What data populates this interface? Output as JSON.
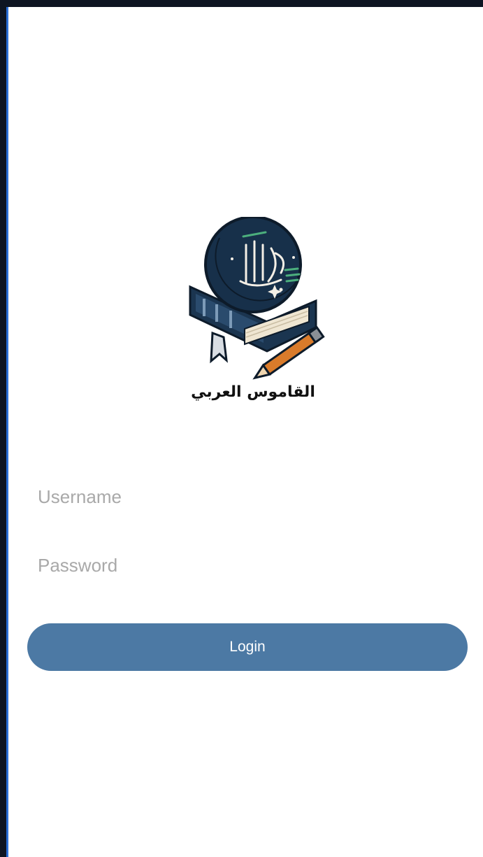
{
  "app": {
    "logo_icon": "dictionary-book-crescent-logo",
    "logo_title": "القاموس العربي"
  },
  "form": {
    "username_placeholder": "Username",
    "username_value": "",
    "password_placeholder": "Password",
    "password_value": "",
    "login_label": "Login"
  },
  "colors": {
    "primary_button": "#4c79a4",
    "placeholder_text": "#a9a9a9",
    "background": "#ffffff",
    "logo_dark": "#17304a",
    "logo_accent_green": "#4caf7d",
    "pencil_orange": "#d97b2b"
  }
}
